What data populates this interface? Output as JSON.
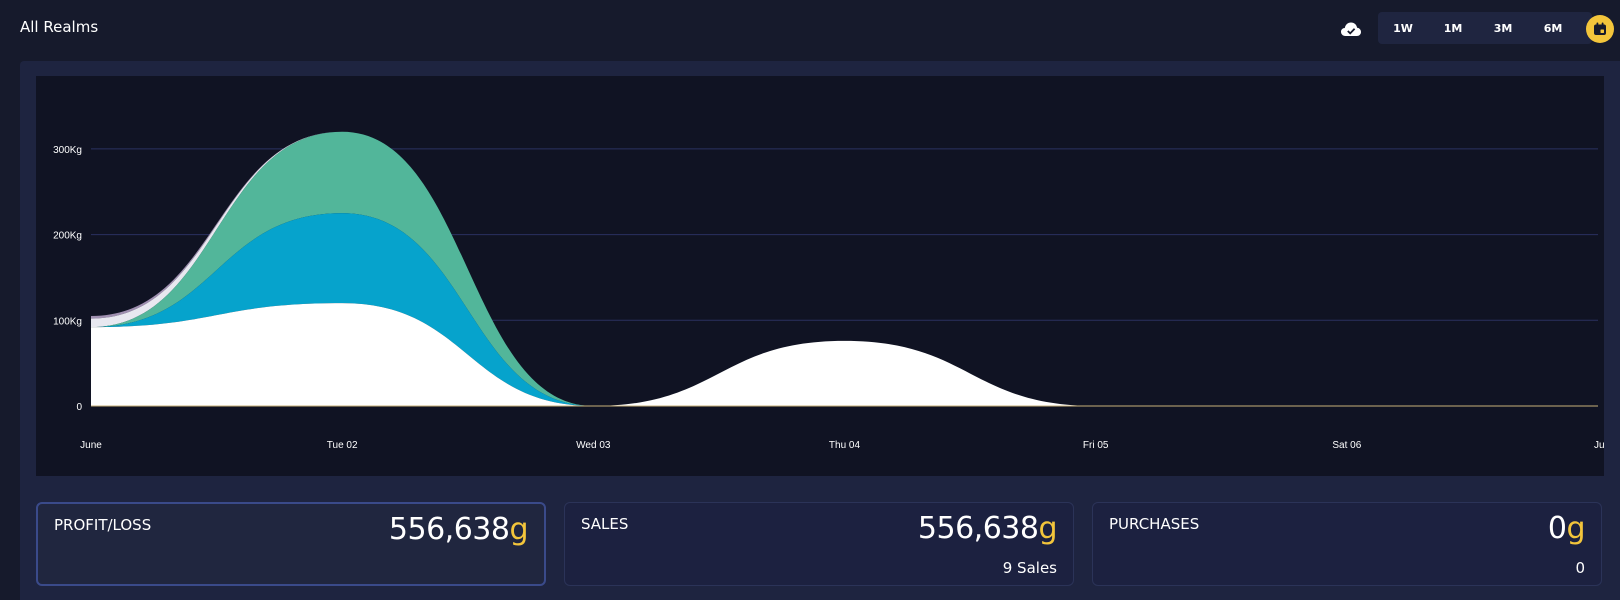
{
  "header": {
    "title": "All Realms",
    "sync_icon": "cloud-check-icon",
    "ranges": [
      "1W",
      "1M",
      "3M",
      "6M"
    ],
    "calendar_icon": "calendar-icon"
  },
  "colors": {
    "background": "#161a2c",
    "chart_bg": "#101323",
    "accent_gold": "#f3c53b",
    "series_teal": "#52b69a",
    "series_blue": "#06a3cc",
    "series_white": "#ffffff"
  },
  "chart_data": {
    "type": "area",
    "stacked": true,
    "x": [
      "June",
      "Tue 02",
      "Wed 03",
      "Thu 04",
      "Fri 05",
      "Sat 06",
      "Jun"
    ],
    "yticks": [
      "0",
      "100Kg",
      "200Kg",
      "300Kg"
    ],
    "ylim": [
      0,
      350
    ],
    "grid": true,
    "series": [
      {
        "color": "#ffffff",
        "values": [
          92,
          120,
          0,
          76,
          0,
          0,
          0
        ]
      },
      {
        "color": "#06a3cc",
        "values": [
          0,
          105,
          0,
          0,
          0,
          0,
          0
        ]
      },
      {
        "color": "#52b69a",
        "values": [
          0,
          95,
          0,
          0,
          0,
          0,
          0
        ]
      },
      {
        "color": "#e8e8f0",
        "values": [
          10,
          0,
          0,
          0,
          0,
          0,
          0
        ]
      },
      {
        "color": "#9f8fb0",
        "values": [
          3,
          0,
          0,
          0,
          0,
          0,
          0
        ]
      }
    ]
  },
  "cards": [
    {
      "label": "PROFIT/LOSS",
      "value": "556,638",
      "unit": "g",
      "sub": ""
    },
    {
      "label": "SALES",
      "value": "556,638",
      "unit": "g",
      "sub": "9 Sales"
    },
    {
      "label": "PURCHASES",
      "value": "0",
      "unit": "g",
      "sub": "0"
    }
  ]
}
